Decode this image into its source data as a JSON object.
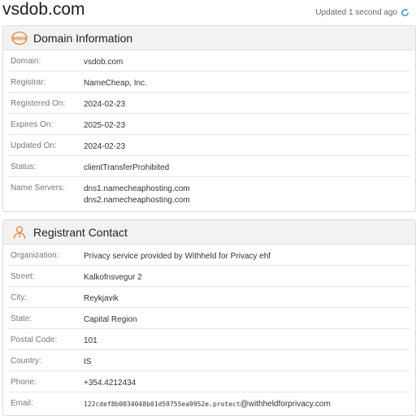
{
  "page": {
    "title": "vsdob.com",
    "updated_text": "Updated 1 second ago"
  },
  "domain_panel": {
    "title": "Domain Information",
    "icon": "www-globe-icon",
    "rows": [
      {
        "label": "Domain:",
        "value": "vsdob.com"
      },
      {
        "label": "Registrar:",
        "value": "NameCheap, Inc."
      },
      {
        "label": "Registered On:",
        "value": "2024-02-23"
      },
      {
        "label": "Expires On:",
        "value": "2025-02-23"
      },
      {
        "label": "Updated On:",
        "value": "2024-02-23"
      },
      {
        "label": "Status:",
        "value": "clientTransferProhibited"
      },
      {
        "label": "Name Servers:",
        "values": [
          "dns1.namecheaphosting.com",
          "dns2.namecheaphosting.com"
        ]
      }
    ]
  },
  "registrant_panel": {
    "title": "Registrant Contact",
    "icon": "person-icon",
    "rows": [
      {
        "label": "Organization:",
        "value": "Privacy service provided by Withheld for Privacy ehf"
      },
      {
        "label": "Street:",
        "value": "Kalkofnsvegur 2"
      },
      {
        "label": "City:",
        "value": "Reykjavik"
      },
      {
        "label": "State:",
        "value": "Capital Region"
      },
      {
        "label": "Postal Code:",
        "value": "101"
      },
      {
        "label": "Country:",
        "value": "IS"
      },
      {
        "label": "Phone:",
        "value": "+354.4212434"
      },
      {
        "label": "Email:",
        "value_mono": "122cdef8b0034048b01d59755ea9952e.protect",
        "value_tail": "@withheldforprivacy.com"
      }
    ]
  },
  "colors": {
    "accent_orange": "#e8833a",
    "refresh_blue": "#3b8fd9"
  }
}
